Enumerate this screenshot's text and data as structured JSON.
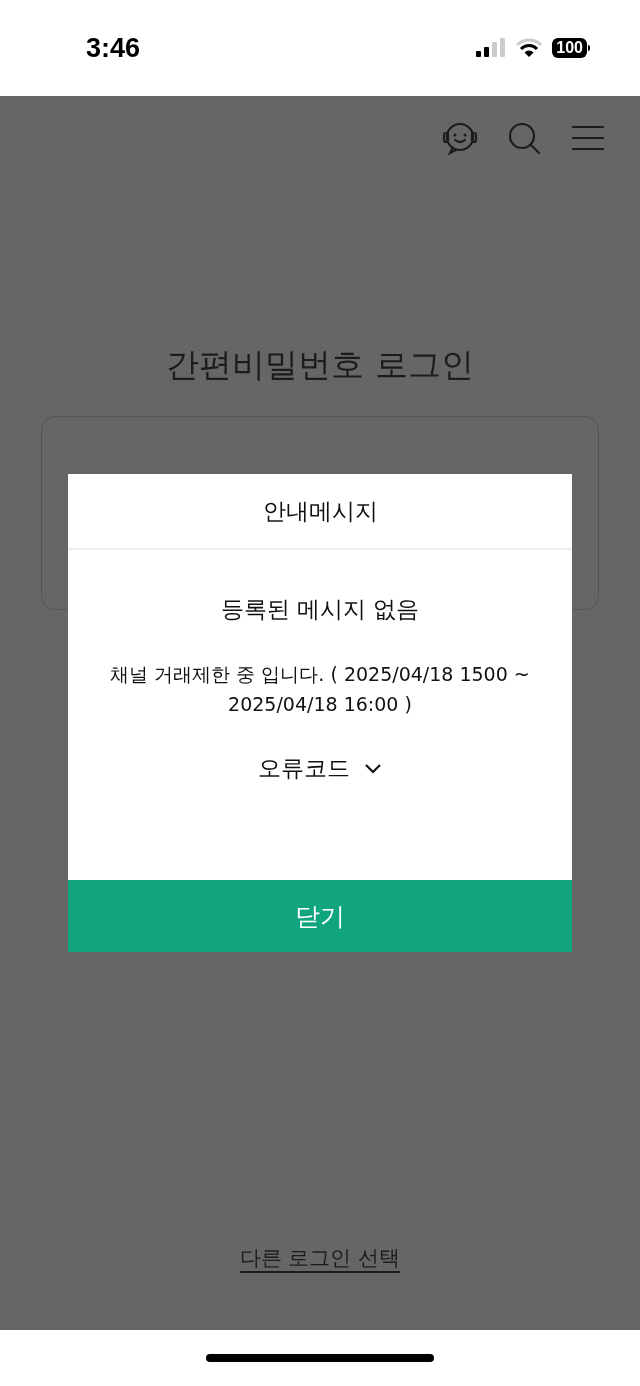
{
  "status_bar": {
    "time": "3:46",
    "battery": "100"
  },
  "page": {
    "title": "간편비밀번호 로그인",
    "other_login_link": "다른 로그인 선택"
  },
  "dialog": {
    "title": "안내메시지",
    "heading": "등록된 메시지 없음",
    "message": "채널 거래제한 중 입니다. ( 2025/04/18 1500 ~ 2025/04/18 16:00 )",
    "error_code": {
      "label": "오류코드",
      "expanded": false
    },
    "close_button": "닫기"
  }
}
